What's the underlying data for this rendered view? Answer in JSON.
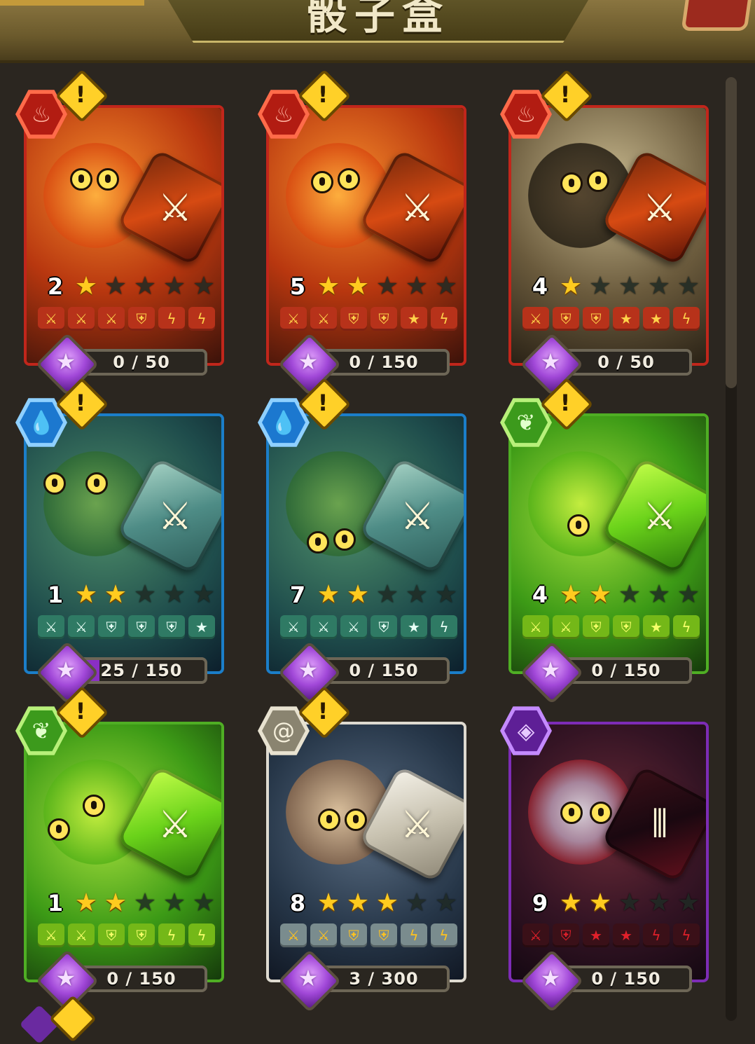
{
  "header": {
    "title": "骰子盒"
  },
  "colors": {
    "fire": "#c1261b",
    "water": "#1b7ec9",
    "earth": "#4fae24",
    "wind": "#dedad0",
    "dark": "#7d2cb6",
    "star_on": "#ffcb1f",
    "gem": "#a148d8",
    "alert": "#ffd028"
  },
  "cards": [
    {
      "element": "fire-icon",
      "level": "2",
      "stars": 1,
      "faces": [
        "sword-icon",
        "sword-icon",
        "sword-icon",
        "shield-icon",
        "lightning-icon",
        "lightning-icon"
      ],
      "progress_text": "0 / 50",
      "progress": 0,
      "alert": true
    },
    {
      "element": "fire-icon",
      "level": "5",
      "stars": 2,
      "faces": [
        "sword-icon",
        "sword-icon",
        "shield-icon",
        "shield-icon",
        "star-icon",
        "lightning-icon"
      ],
      "progress_text": "0 / 150",
      "progress": 0,
      "alert": true
    },
    {
      "element": "fire-icon",
      "level": "4",
      "stars": 1,
      "faces": [
        "sword-icon",
        "shield-icon",
        "shield-icon",
        "star-icon",
        "star-icon",
        "lightning-icon"
      ],
      "progress_text": "0 / 50",
      "progress": 0,
      "alert": true
    },
    {
      "element": "water-icon",
      "level": "1",
      "stars": 2,
      "faces": [
        "sword-icon",
        "sword-icon",
        "shield-icon",
        "shield-icon",
        "shield-icon",
        "star-icon"
      ],
      "progress_text": "25 / 150",
      "progress": 0.167,
      "alert": true
    },
    {
      "element": "water-icon",
      "level": "7",
      "stars": 2,
      "faces": [
        "sword-icon",
        "sword-icon",
        "sword-icon",
        "shield-icon",
        "star-icon",
        "lightning-icon"
      ],
      "progress_text": "0 / 150",
      "progress": 0,
      "alert": true
    },
    {
      "element": "leaf-icon",
      "level": "4",
      "stars": 2,
      "faces": [
        "sword-icon",
        "sword-icon",
        "shield-icon",
        "shield-icon",
        "star-icon",
        "lightning-icon"
      ],
      "progress_text": "0 / 150",
      "progress": 0,
      "alert": true
    },
    {
      "element": "leaf-icon",
      "level": "1",
      "stars": 2,
      "faces": [
        "sword-icon",
        "sword-icon",
        "shield-icon",
        "shield-icon",
        "lightning-icon",
        "lightning-icon"
      ],
      "progress_text": "0 / 150",
      "progress": 0,
      "alert": true
    },
    {
      "element": "swirl-icon",
      "level": "8",
      "stars": 3,
      "faces": [
        "sword-icon",
        "sword-icon",
        "shield-icon",
        "shield-icon",
        "lightning-icon",
        "lightning-icon"
      ],
      "progress_text": "3 / 300",
      "progress": 0.01,
      "alert": true
    },
    {
      "element": "dark-orb-icon",
      "level": "9",
      "stars": 2,
      "faces": [
        "sword-icon",
        "shield-icon",
        "star-icon",
        "star-icon",
        "lightning-icon",
        "lightning-icon"
      ],
      "progress_text": "0 / 150",
      "progress": 0,
      "alert": false
    }
  ]
}
